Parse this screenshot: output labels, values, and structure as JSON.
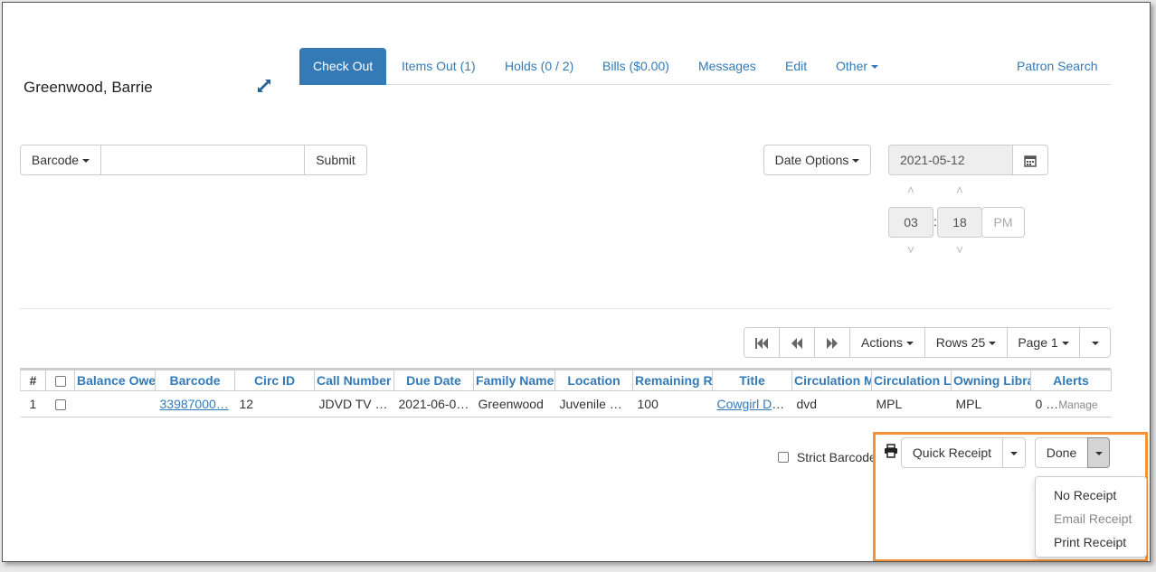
{
  "patron": {
    "name": "Greenwood, Barrie"
  },
  "nav": {
    "tabs": [
      {
        "label": "Check Out",
        "active": true
      },
      {
        "label": "Items Out (1)"
      },
      {
        "label": "Holds (0 / 2)"
      },
      {
        "label": "Bills ($0.00)"
      },
      {
        "label": "Messages"
      },
      {
        "label": "Edit"
      },
      {
        "label": "Other"
      }
    ],
    "patron_search": "Patron Search"
  },
  "checkout": {
    "barcode_label": "Barcode",
    "barcode_value": "",
    "submit_label": "Submit",
    "date_options_label": "Date Options",
    "date_value": "2021-05-12",
    "hour": "03",
    "minute": "18",
    "ampm": "PM",
    "time_separator": ":"
  },
  "pager": {
    "actions_label": "Actions",
    "rows_label": "Rows 25",
    "page_label": "Page 1"
  },
  "table": {
    "columns": [
      "#",
      "",
      "Balance Owed",
      "Barcode",
      "Circ ID",
      "Call Number",
      "Due Date",
      "Family Name",
      "Location",
      "Remaining Renewals",
      "Title",
      "Circulation Modifier",
      "Circulation Library",
      "Owning Library",
      "Alerts"
    ],
    "rows": [
      {
        "num": "1",
        "balance": "",
        "barcode": "33987000…",
        "circ_id": "12",
        "call_number": "JDVD TV …",
        "due_date": "2021-06-0…",
        "family_name": "Greenwood",
        "location": "Juvenile D…",
        "remaining": "100",
        "title": "Cowgirl Do…",
        "circ_modifier": "dvd",
        "circ_library": "MPL",
        "owning_library": "MPL",
        "alerts_count": "0 …",
        "alerts_link": "Manage"
      }
    ]
  },
  "footer": {
    "strict_barcode_label": "Strict Barcode",
    "quick_receipt_label": "Quick Receipt",
    "done_label": "Done",
    "menu": [
      {
        "label": "No Receipt",
        "disabled": false
      },
      {
        "label": "Email Receipt",
        "disabled": true
      },
      {
        "label": "Print Receipt",
        "disabled": false
      }
    ]
  },
  "colors": {
    "primary": "#337ab7",
    "highlight": "#f39237"
  }
}
